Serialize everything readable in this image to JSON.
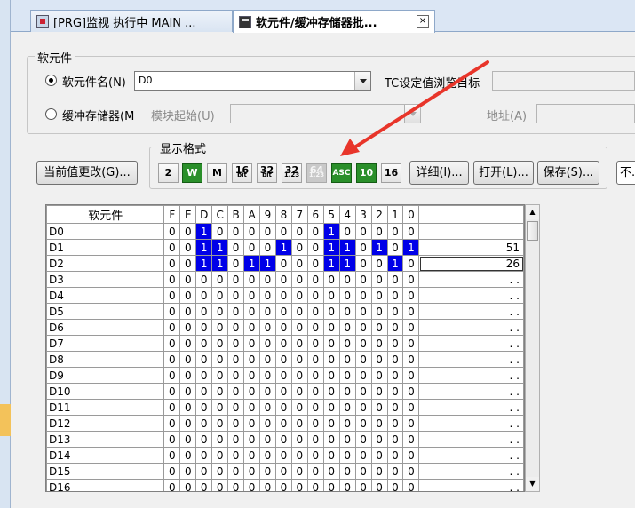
{
  "tabs": [
    {
      "label": "[PRG]监视 执行中 MAIN ..."
    },
    {
      "label": "软元件/缓冲存储器批...",
      "close": "×"
    }
  ],
  "device_group": {
    "title": "软元件",
    "device_name_label": "软元件名(N)",
    "device_name_value": "D0",
    "tc_label": "TC设定值浏览目标",
    "buffer_label": "缓冲存储器(M",
    "module_start_label": "模块起始(U)",
    "address_label": "地址(A)"
  },
  "format_group": {
    "title": "显示格式",
    "buttons": [
      {
        "id": "bin",
        "text": "2"
      },
      {
        "id": "word",
        "text": "W"
      },
      {
        "id": "dword",
        "text": "M"
      },
      {
        "id": "bit16",
        "text": "16",
        "sub": "bit"
      },
      {
        "id": "bit32",
        "text": "32",
        "sub": "bit"
      },
      {
        "id": "real32",
        "text": "32",
        "sub": "1.23"
      },
      {
        "id": "real64",
        "text": "64",
        "sub": "1.23"
      },
      {
        "id": "ascii",
        "text": "ASC"
      },
      {
        "id": "dec",
        "text": "10"
      },
      {
        "id": "hex",
        "text": "16"
      }
    ]
  },
  "toolbar": {
    "change_value": "当前值更改(G)...",
    "detail": "详细(I)...",
    "open": "打开(L)...",
    "save": "保存(S)...",
    "right_cut": "不..."
  },
  "table": {
    "header_name": "软元件",
    "bit_headers": [
      "F",
      "E",
      "D",
      "C",
      "B",
      "A",
      "9",
      "8",
      "7",
      "6",
      "5",
      "4",
      "3",
      "2",
      "1",
      "0"
    ],
    "rows": [
      {
        "name": "D0",
        "bits": "0010000000100000",
        "value": ""
      },
      {
        "name": "D1",
        "bits": "0011000100110101",
        "value": "51"
      },
      {
        "name": "D2",
        "bits": "0011011000110010",
        "value": "26"
      },
      {
        "name": "D3",
        "bits": "0000000000000000",
        "value": ". ."
      },
      {
        "name": "D4",
        "bits": "0000000000000000",
        "value": ". ."
      },
      {
        "name": "D5",
        "bits": "0000000000000000",
        "value": ". ."
      },
      {
        "name": "D6",
        "bits": "0000000000000000",
        "value": ". ."
      },
      {
        "name": "D7",
        "bits": "0000000000000000",
        "value": ". ."
      },
      {
        "name": "D8",
        "bits": "0000000000000000",
        "value": ". ."
      },
      {
        "name": "D9",
        "bits": "0000000000000000",
        "value": ". ."
      },
      {
        "name": "D10",
        "bits": "0000000000000000",
        "value": ". ."
      },
      {
        "name": "D11",
        "bits": "0000000000000000",
        "value": ". ."
      },
      {
        "name": "D12",
        "bits": "0000000000000000",
        "value": ". ."
      },
      {
        "name": "D13",
        "bits": "0000000000000000",
        "value": ". ."
      },
      {
        "name": "D14",
        "bits": "0000000000000000",
        "value": ". ."
      },
      {
        "name": "D15",
        "bits": "0000000000000000",
        "value": ". ."
      },
      {
        "name": "D16",
        "bits": "0000000000000000",
        "value": ". ."
      }
    ]
  },
  "colors": {
    "bit_on": "#0000e8",
    "format_active": "#2a8f2a",
    "annotation_arrow": "#e8352a"
  }
}
